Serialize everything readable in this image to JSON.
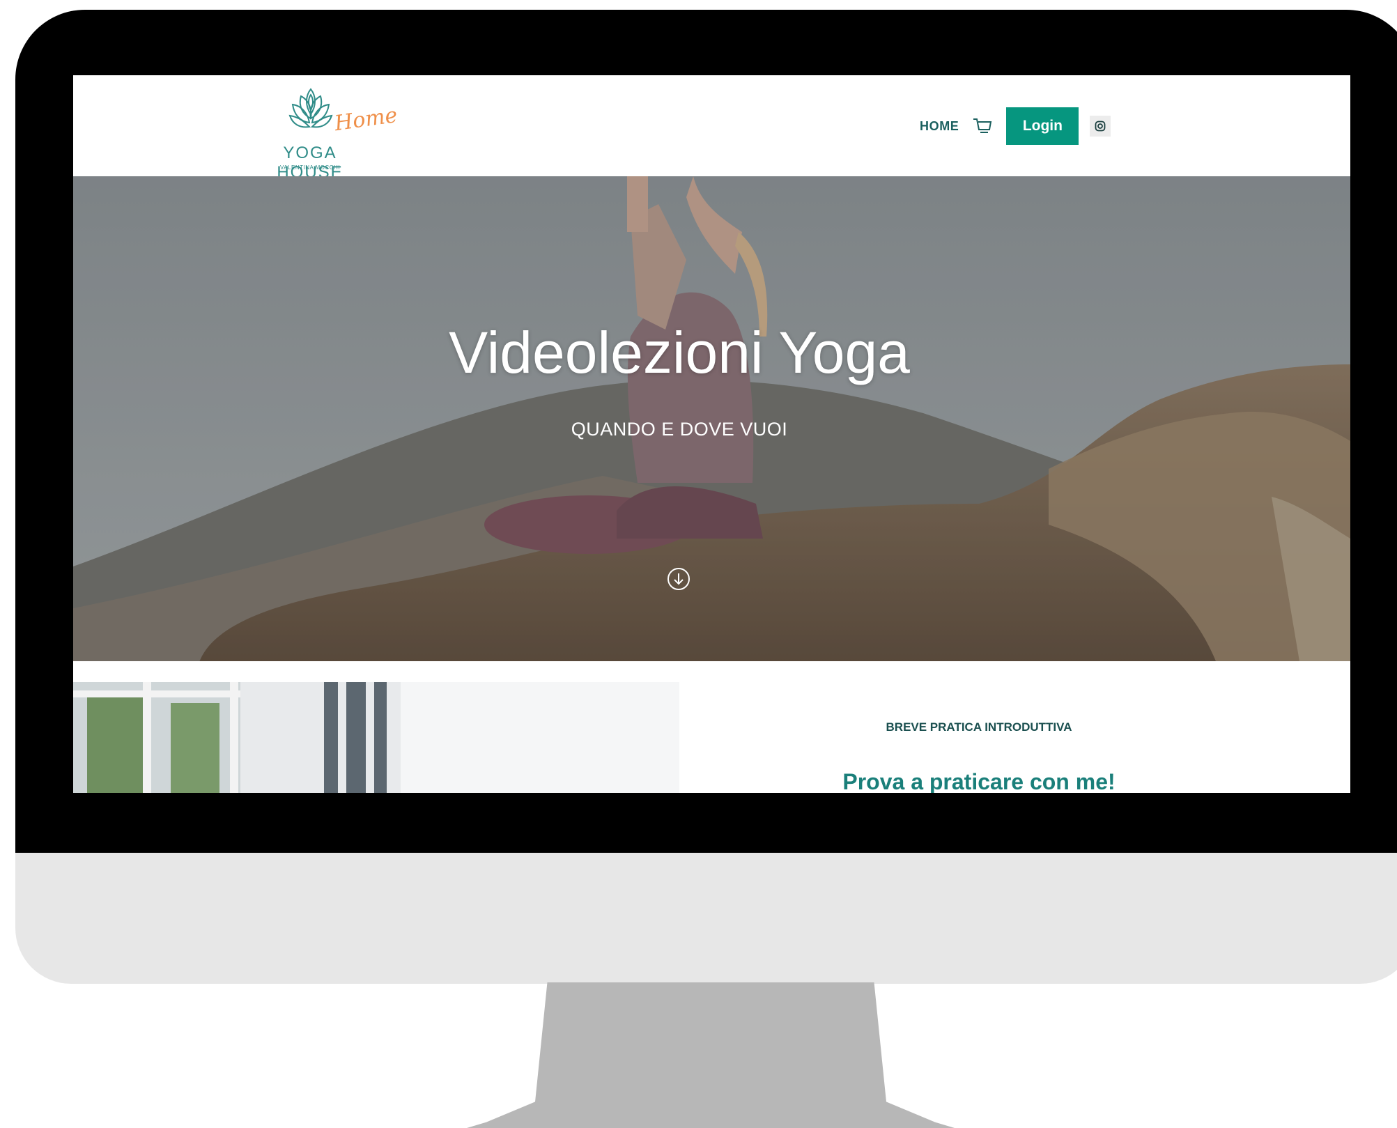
{
  "header": {
    "logo": {
      "name": "YOGA HOUSE",
      "script": "Home",
      "subtitle": "VALENTINA MOCCHI"
    },
    "nav": {
      "home_label": "HOME",
      "login_label": "Login",
      "icons": [
        "cart-icon",
        "instagram-icon"
      ]
    }
  },
  "hero": {
    "title": "Videolezioni Yoga",
    "subtitle": "QUANDO E DOVE VUOI",
    "scroll_icon": "arrow-down-circle-icon"
  },
  "intro": {
    "label": "BREVE PRATICA INTRODUTTIVA",
    "title": "Prova a praticare con me!"
  },
  "colors": {
    "accent": "#06967f",
    "logo_teal": "#2f8c88",
    "logo_orange": "#ef8f49",
    "heading_teal": "#1a7f7a",
    "nav_text": "#1a5f5e"
  }
}
